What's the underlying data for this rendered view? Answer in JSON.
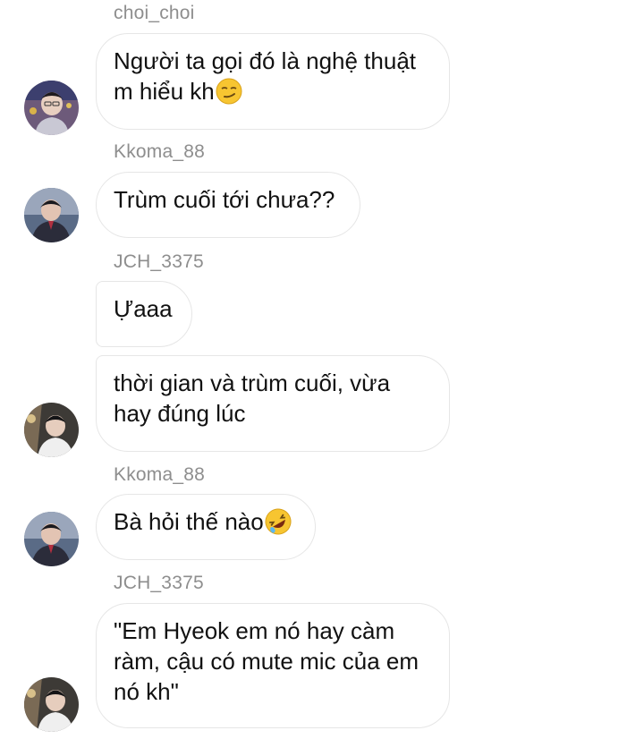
{
  "messages": [
    {
      "sender": "choi_choi",
      "text": "Người ta gọi đó là nghệ thuật m hiểu kh",
      "emoji": "smirk-emoji"
    },
    {
      "sender": "Kkoma_88",
      "text": "Trùm cuối tới chưa??"
    },
    {
      "sender": "JCH_3375",
      "text": "Ựaaa"
    },
    {
      "sender": "",
      "text": "thời gian và trùm cuối, vừa hay đúng lúc"
    },
    {
      "sender": "Kkoma_88",
      "text": "Bà hỏi thế nào",
      "emoji": "rofl-emoji"
    },
    {
      "sender": "JCH_3375",
      "text": "\"Em Hyeok em nó hay càm ràm, cậu có mute mic của em nó kh\""
    }
  ],
  "colors": {
    "background": "#ffffff",
    "bubble_border": "#e6e6e6",
    "sender_text": "#8e8e8e",
    "message_text": "#111111",
    "emoji_face": "#f7c531"
  }
}
